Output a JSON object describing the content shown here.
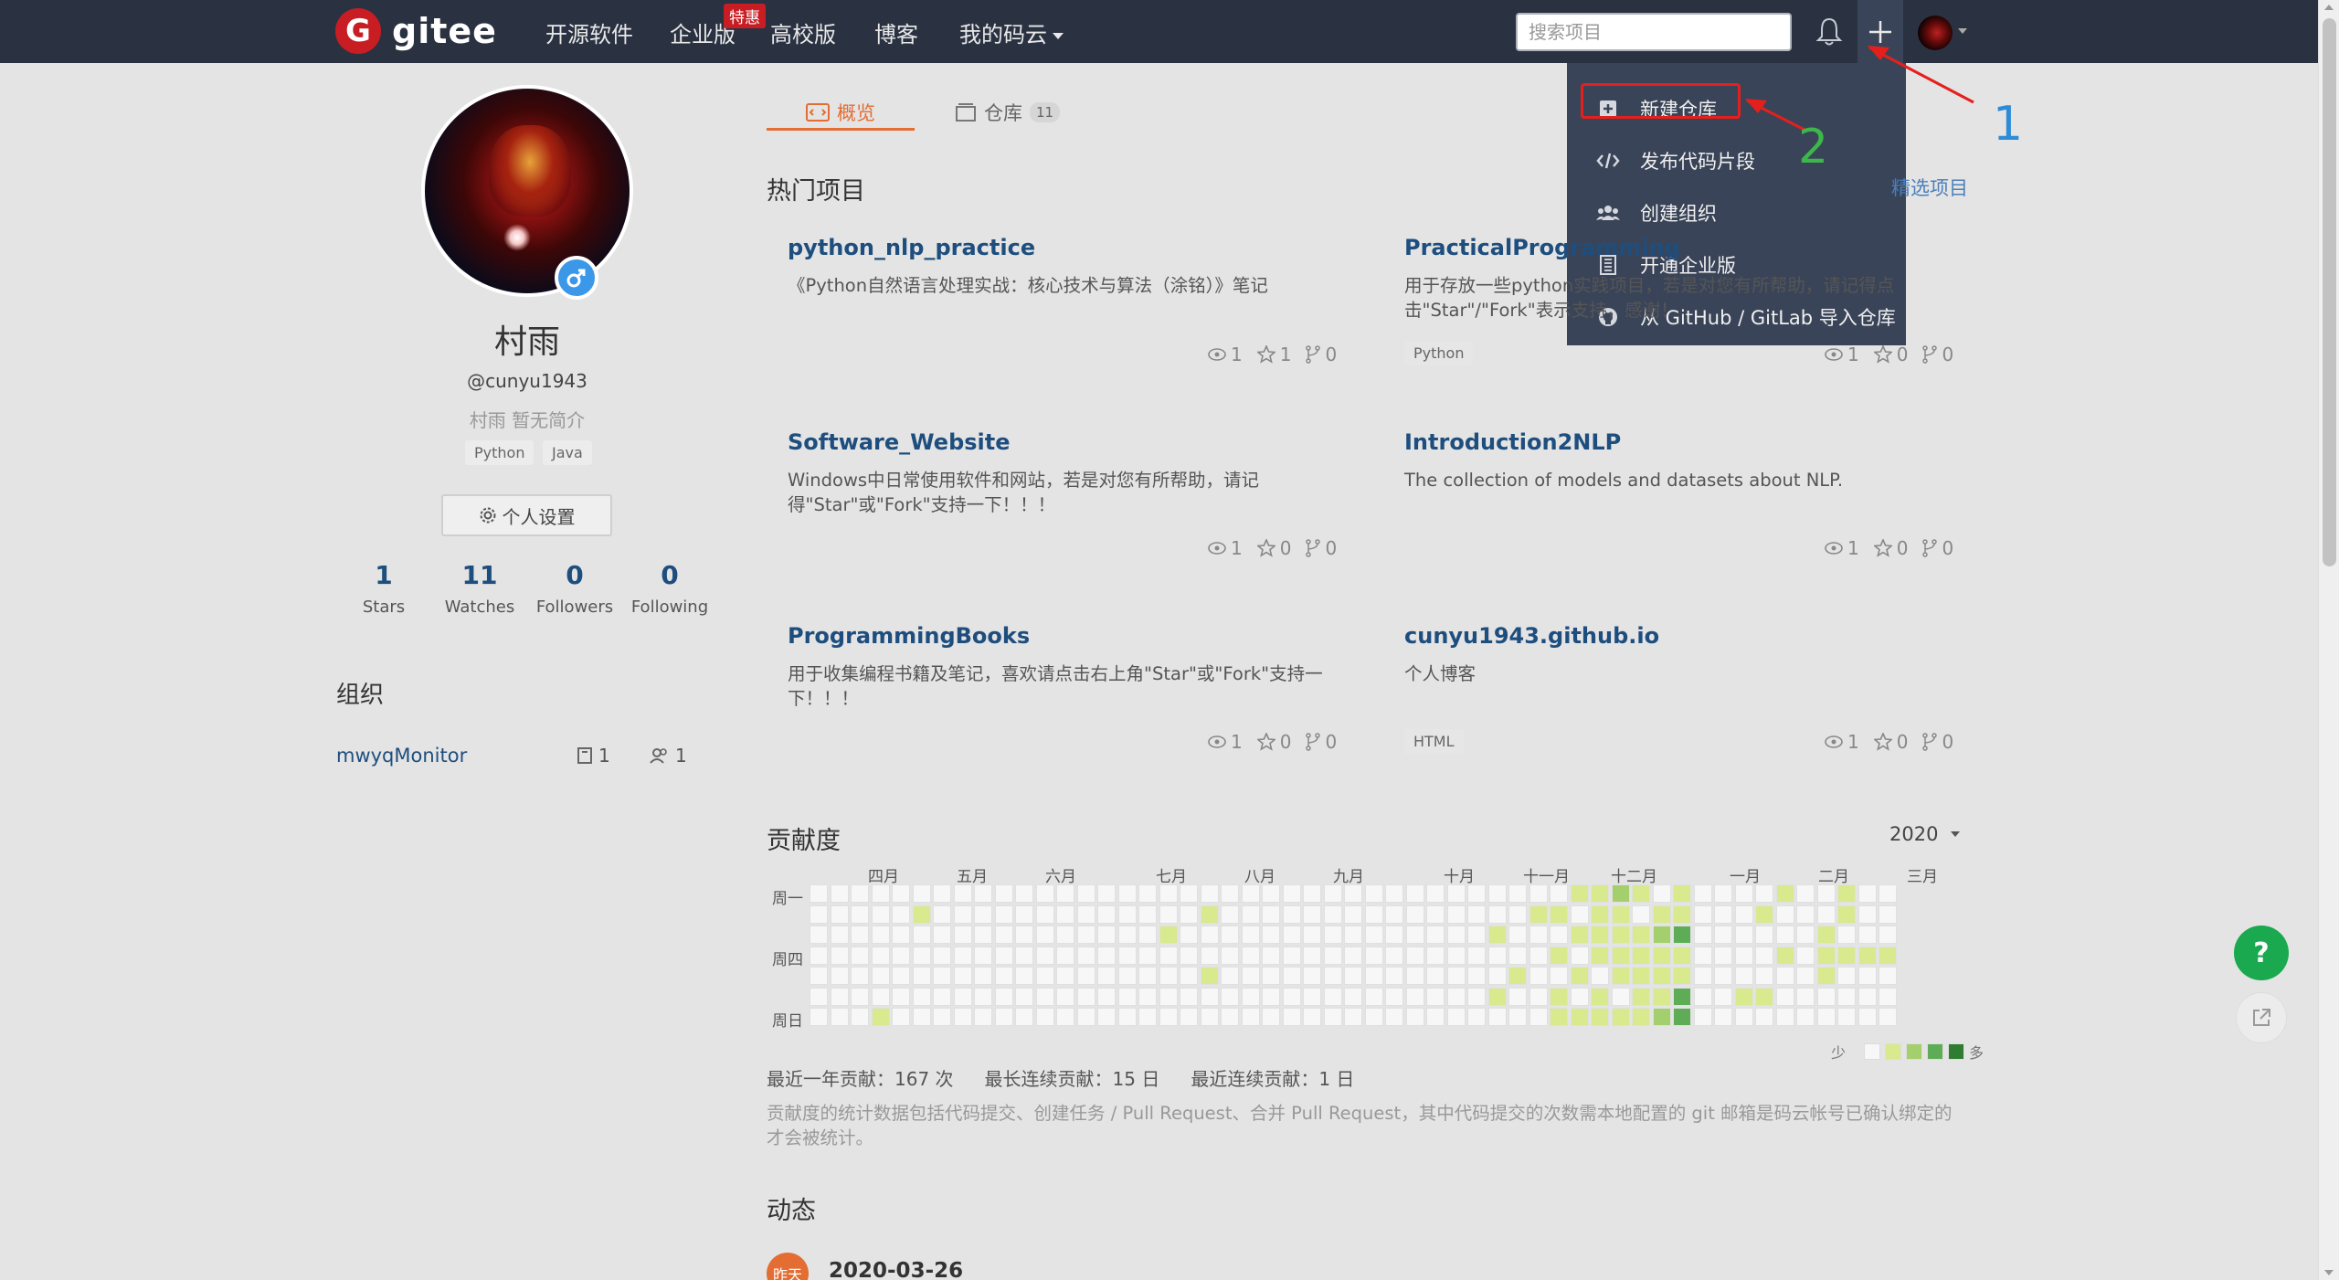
{
  "navbar": {
    "logo_mark": "G",
    "logo_text": "gitee",
    "links": [
      "开源软件",
      "企业版",
      "高校版",
      "博客",
      "我的码云"
    ],
    "enterprise_badge": "特惠",
    "search_placeholder": "搜索项目"
  },
  "dropdown": {
    "items": [
      {
        "label": "新建仓库",
        "icon": "plus-square-icon"
      },
      {
        "label": "发布代码片段",
        "icon": "code-icon"
      },
      {
        "label": "创建组织",
        "icon": "group-icon"
      },
      {
        "label": "开通企业版",
        "icon": "building-icon"
      },
      {
        "label": "从 GitHub / GitLab 导入仓库",
        "icon": "github-icon"
      }
    ]
  },
  "annotations": {
    "one": "1",
    "two": "2"
  },
  "profile": {
    "name": "村雨",
    "handle": "@cunyu1943",
    "bio": "村雨 暂无简介",
    "tags": [
      "Python",
      "Java"
    ],
    "settings_label": "个人设置",
    "stats": [
      {
        "value": "1",
        "label": "Stars"
      },
      {
        "value": "11",
        "label": "Watches"
      },
      {
        "value": "0",
        "label": "Followers"
      },
      {
        "value": "0",
        "label": "Following"
      }
    ],
    "org_title": "组织",
    "org": {
      "name": "mwyqMonitor",
      "repos": "1",
      "members": "1"
    }
  },
  "tabs": [
    {
      "label": "概览"
    },
    {
      "label": "仓库",
      "count": "11"
    }
  ],
  "hot_projects": {
    "title": "热门项目",
    "featured_link": "精选项目",
    "cards": [
      {
        "title": "python_nlp_practice",
        "desc": "《Python自然语言处理实战：核心技术与算法（涂铭）》笔记",
        "lang": "",
        "watch": "1",
        "star": "1",
        "fork": "0"
      },
      {
        "title": "PracticalProgramming",
        "desc": "用于存放一些python实践项目，若是对您有所帮助，请记得点击\"Star\"/\"Fork\"表示支持，感谢！",
        "lang": "Python",
        "watch": "1",
        "star": "0",
        "fork": "0"
      },
      {
        "title": "Software_Website",
        "desc": "Windows中日常使用软件和网站，若是对您有所帮助，请记得\"Star\"或\"Fork\"支持一下！！！",
        "lang": "",
        "watch": "1",
        "star": "0",
        "fork": "0"
      },
      {
        "title": "Introduction2NLP",
        "desc": "The collection of models and datasets about NLP.",
        "lang": "",
        "watch": "1",
        "star": "0",
        "fork": "0"
      },
      {
        "title": "ProgrammingBooks",
        "desc": "用于收集编程书籍及笔记，喜欢请点击右上角\"Star\"或\"Fork\"支持一下！！！",
        "lang": "",
        "watch": "1",
        "star": "0",
        "fork": "0"
      },
      {
        "title": "cunyu1943.github.io",
        "desc": "个人博客",
        "lang": "HTML",
        "watch": "1",
        "star": "0",
        "fork": "0"
      }
    ]
  },
  "contribution": {
    "title": "贡献度",
    "year": "2020",
    "months": [
      "四月",
      "五月",
      "六月",
      "七月",
      "八月",
      "九月",
      "十月",
      "十一月",
      "十二月",
      "一月",
      "二月",
      "三月"
    ],
    "day_labels": [
      "周一",
      "周四",
      "周日"
    ],
    "legend_less": "少",
    "legend_more": "多",
    "colors": [
      "#f7f7f7",
      "#d9ea8e",
      "#a3d06c",
      "#5ead56",
      "#2e7d32"
    ],
    "summary": [
      "最近一年贡献：167 次",
      "最长连续贡献：15 日",
      "最近连续贡献：1 日"
    ],
    "note": "贡献度的统计数据包括代码提交、创建任务 / Pull Request、合并 Pull Request，其中代码提交的次数需本地配置的 git 邮箱是码云帐号已确认绑定的才会被统计。"
  },
  "activity": {
    "title": "动态",
    "badge": "昨天",
    "date": "2020-03-26"
  },
  "floating": {
    "help": "?"
  }
}
